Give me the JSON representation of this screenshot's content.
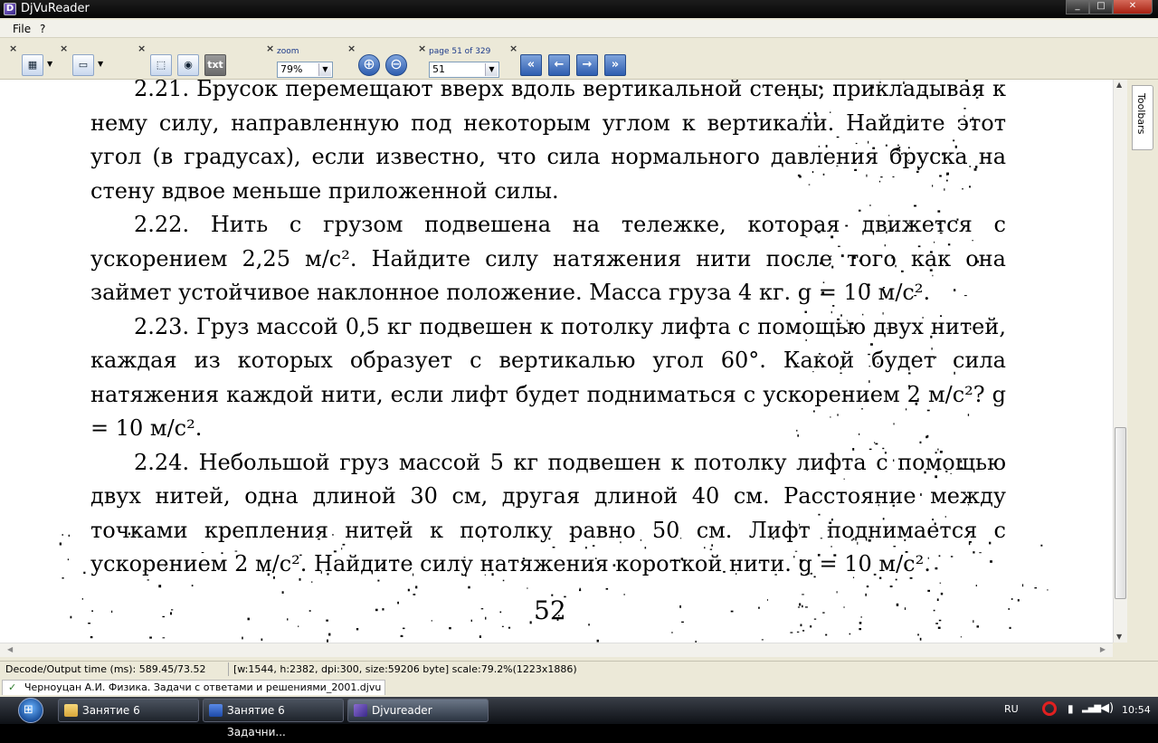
{
  "window": {
    "title": "DjVuReader",
    "minimize": "_",
    "maximize": "□",
    "close": "✕"
  },
  "menu": {
    "file": "File",
    "help": "?"
  },
  "toolbar": {
    "zoom_label": "zoom",
    "zoom_value": "79%",
    "page_label": "page 51 of 329",
    "page_value": "51",
    "text_button": "txt",
    "zoom_in": "⊕",
    "zoom_out": "⊖",
    "first": "«",
    "prev": "←",
    "next": "→",
    "last": "»"
  },
  "page": {
    "p1": "2.21. Брусок перемещают вверх вдоль вертикальной стены, прикладывая к нему силу, направленную под некоторым углом к вертикали. Найдите этот угол (в градусах), если известно, что сила нормального давления бруска на стену вдвое меньше приложенной силы.",
    "p2": "2.22. Нить с грузом подвешена на тележке, которая движется с ускорением 2,25 м/с². Найдите силу натяжения нити после того как она займет устойчивое наклонное положение. Масса груза 4 кг. g = 10 м/с².",
    "p3": "2.23. Груз массой 0,5 кг подвешен к потолку лифта с помощью двух нитей, каждая из которых образует с вертикалью угол 60°. Какой будет сила натяжения каждой нити, если лифт будет подниматься с ускорением 2 м/с²? g = 10 м/с².",
    "p4": "2.24. Небольшой груз массой 5 кг подвешен к потолку лифта с помощью двух нитей, одна длиной 30 см, другая длиной 40 см. Расстояние между точками крепления нитей к потолку равно 50 см. Лифт поднимается с ускорением 2 м/с². Найдите силу натяжения короткой нити. g = 10 м/с².",
    "page_number": "52"
  },
  "sidebar": {
    "toolbars_tab": "Toolbars"
  },
  "status": {
    "decode": "Decode/Output time (ms): 589.45/73.52",
    "info": "[w:1544, h:2382, dpi:300, size:59206 byte] scale:79.2%(1223x1886)"
  },
  "file_tab": "Черноуцан А.И. Физика. Задачи с ответами и решениями_2001.djvu",
  "taskbar": {
    "items": [
      "Занятие 6",
      "Занятие 6 Задачни...",
      "Djvureader"
    ],
    "lang": "RU",
    "time": "10:54"
  }
}
